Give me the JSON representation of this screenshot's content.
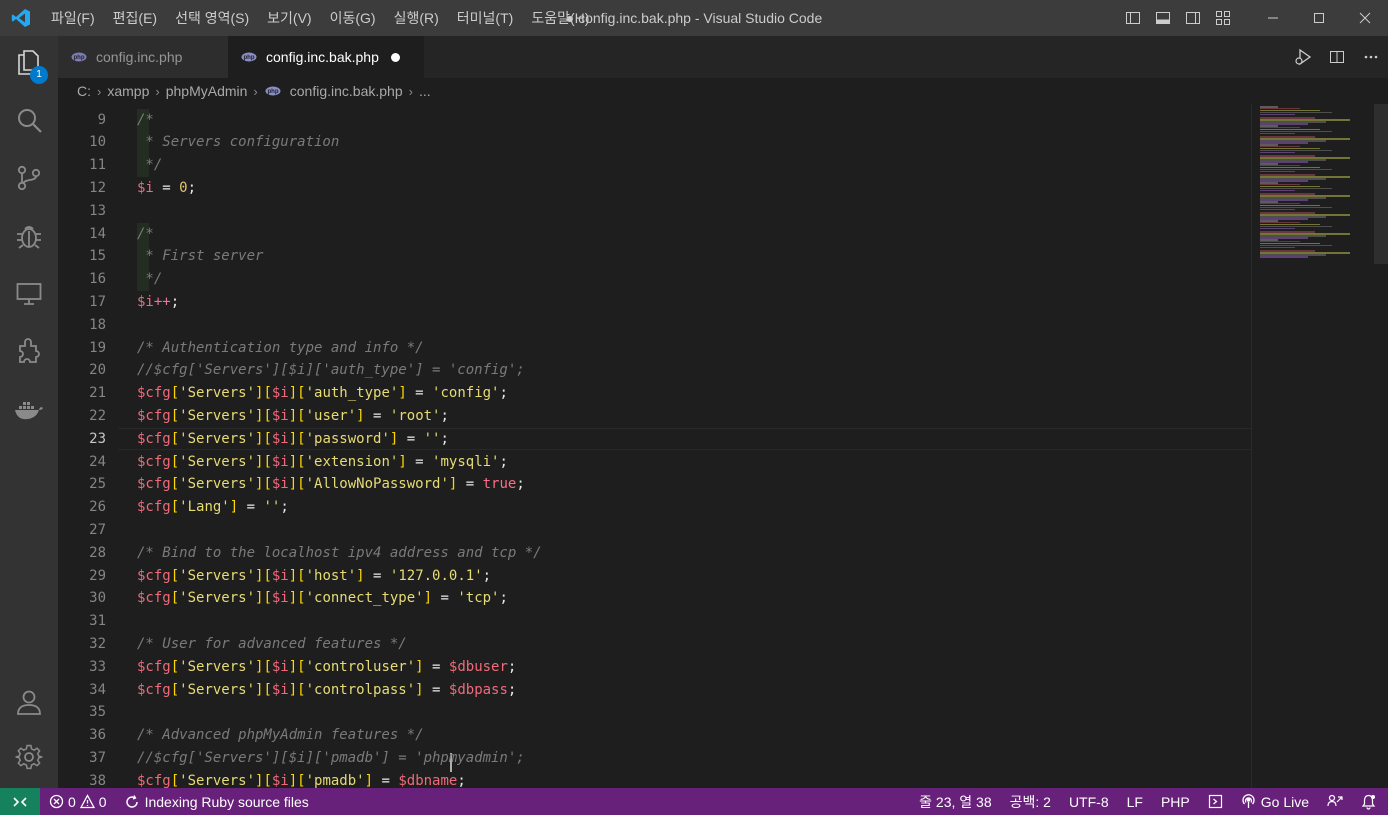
{
  "window": {
    "title": "● config.inc.bak.php - Visual Studio Code",
    "menu": [
      "파일(F)",
      "편집(E)",
      "선택 영역(S)",
      "보기(V)",
      "이동(G)",
      "실행(R)",
      "터미널(T)",
      "도움말(H)"
    ]
  },
  "activity_bar": {
    "explorer_badge": "1",
    "icons": [
      "explorer-icon",
      "search-icon",
      "source-control-icon",
      "debug-icon",
      "remote-explorer-icon",
      "extensions-icon",
      "docker-icon",
      "account-icon",
      "settings-gear-icon"
    ]
  },
  "tabs": [
    {
      "label": "config.inc.php",
      "active": false
    },
    {
      "label": "config.inc.bak.php",
      "active": true,
      "dirty": true
    }
  ],
  "breadcrumb": [
    "C:",
    "xampp",
    "phpMyAdmin",
    "config.inc.bak.php",
    "..."
  ],
  "editor": {
    "active_line": 23,
    "lines": [
      {
        "n": "9",
        "tokens": [
          [
            "c-com",
            "/*"
          ]
        ]
      },
      {
        "n": "10",
        "tokens": [
          [
            "c-com",
            " * Servers configuration"
          ]
        ]
      },
      {
        "n": "11",
        "tokens": [
          [
            "c-com",
            " */"
          ]
        ]
      },
      {
        "n": "12",
        "tokens": [
          [
            "c-var",
            "$i"
          ],
          [
            "c-plain",
            " = "
          ],
          [
            "c-num",
            "0"
          ],
          [
            "c-plain",
            ";"
          ]
        ]
      },
      {
        "n": "13",
        "tokens": []
      },
      {
        "n": "14",
        "tokens": [
          [
            "c-com",
            "/*"
          ]
        ]
      },
      {
        "n": "15",
        "tokens": [
          [
            "c-com",
            " * First server"
          ]
        ]
      },
      {
        "n": "16",
        "tokens": [
          [
            "c-com",
            " */"
          ]
        ]
      },
      {
        "n": "17",
        "tokens": [
          [
            "c-var",
            "$i"
          ],
          [
            "c-op",
            "++"
          ],
          [
            "c-plain",
            ";"
          ]
        ]
      },
      {
        "n": "18",
        "tokens": []
      },
      {
        "n": "19",
        "tokens": [
          [
            "c-com",
            "/* Authentication type and info */"
          ]
        ]
      },
      {
        "n": "20",
        "tokens": [
          [
            "c-com",
            "//$cfg['Servers'][$i]['auth_type'] = 'config';"
          ]
        ]
      },
      {
        "n": "21",
        "tokens": [
          [
            "c-var",
            "$cfg"
          ],
          [
            "c-br",
            "["
          ],
          [
            "c-str",
            "'Servers'"
          ],
          [
            "c-br",
            "]["
          ],
          [
            "c-var",
            "$i"
          ],
          [
            "c-br",
            "]["
          ],
          [
            "c-str",
            "'auth_type'"
          ],
          [
            "c-br",
            "]"
          ],
          [
            "c-plain",
            " = "
          ],
          [
            "c-str",
            "'config'"
          ],
          [
            "c-plain",
            ";"
          ]
        ]
      },
      {
        "n": "22",
        "tokens": [
          [
            "c-var",
            "$cfg"
          ],
          [
            "c-br",
            "["
          ],
          [
            "c-str",
            "'Servers'"
          ],
          [
            "c-br",
            "]["
          ],
          [
            "c-var",
            "$i"
          ],
          [
            "c-br",
            "]["
          ],
          [
            "c-str",
            "'user'"
          ],
          [
            "c-br",
            "]"
          ],
          [
            "c-plain",
            " = "
          ],
          [
            "c-str",
            "'root'"
          ],
          [
            "c-plain",
            ";"
          ]
        ]
      },
      {
        "n": "23",
        "tokens": [
          [
            "c-var",
            "$cfg"
          ],
          [
            "c-br",
            "["
          ],
          [
            "c-str",
            "'Servers'"
          ],
          [
            "c-br",
            "]["
          ],
          [
            "c-var",
            "$i"
          ],
          [
            "c-br",
            "]["
          ],
          [
            "c-str",
            "'password'"
          ],
          [
            "c-br",
            "]"
          ],
          [
            "c-plain",
            " = "
          ],
          [
            "c-str",
            "''"
          ],
          [
            "c-plain",
            ";"
          ]
        ]
      },
      {
        "n": "24",
        "tokens": [
          [
            "c-var",
            "$cfg"
          ],
          [
            "c-br",
            "["
          ],
          [
            "c-str",
            "'Servers'"
          ],
          [
            "c-br",
            "]["
          ],
          [
            "c-var",
            "$i"
          ],
          [
            "c-br",
            "]["
          ],
          [
            "c-str",
            "'extension'"
          ],
          [
            "c-br",
            "]"
          ],
          [
            "c-plain",
            " = "
          ],
          [
            "c-str",
            "'mysqli'"
          ],
          [
            "c-plain",
            ";"
          ]
        ]
      },
      {
        "n": "25",
        "tokens": [
          [
            "c-var",
            "$cfg"
          ],
          [
            "c-br",
            "["
          ],
          [
            "c-str",
            "'Servers'"
          ],
          [
            "c-br",
            "]["
          ],
          [
            "c-var",
            "$i"
          ],
          [
            "c-br",
            "]["
          ],
          [
            "c-str",
            "'AllowNoPassword'"
          ],
          [
            "c-br",
            "]"
          ],
          [
            "c-plain",
            " = "
          ],
          [
            "c-bool",
            "true"
          ],
          [
            "c-plain",
            ";"
          ]
        ]
      },
      {
        "n": "26",
        "tokens": [
          [
            "c-var",
            "$cfg"
          ],
          [
            "c-br",
            "["
          ],
          [
            "c-str",
            "'Lang'"
          ],
          [
            "c-br",
            "]"
          ],
          [
            "c-plain",
            " = "
          ],
          [
            "c-str",
            "''"
          ],
          [
            "c-plain",
            ";"
          ]
        ]
      },
      {
        "n": "27",
        "tokens": []
      },
      {
        "n": "28",
        "tokens": [
          [
            "c-com",
            "/* Bind to the localhost ipv4 address and tcp */"
          ]
        ]
      },
      {
        "n": "29",
        "tokens": [
          [
            "c-var",
            "$cfg"
          ],
          [
            "c-br",
            "["
          ],
          [
            "c-str",
            "'Servers'"
          ],
          [
            "c-br",
            "]["
          ],
          [
            "c-var",
            "$i"
          ],
          [
            "c-br",
            "]["
          ],
          [
            "c-str",
            "'host'"
          ],
          [
            "c-br",
            "]"
          ],
          [
            "c-plain",
            " = "
          ],
          [
            "c-str",
            "'127.0.0.1'"
          ],
          [
            "c-plain",
            ";"
          ]
        ]
      },
      {
        "n": "30",
        "tokens": [
          [
            "c-var",
            "$cfg"
          ],
          [
            "c-br",
            "["
          ],
          [
            "c-str",
            "'Servers'"
          ],
          [
            "c-br",
            "]["
          ],
          [
            "c-var",
            "$i"
          ],
          [
            "c-br",
            "]["
          ],
          [
            "c-str",
            "'connect_type'"
          ],
          [
            "c-br",
            "]"
          ],
          [
            "c-plain",
            " = "
          ],
          [
            "c-str",
            "'tcp'"
          ],
          [
            "c-plain",
            ";"
          ]
        ]
      },
      {
        "n": "31",
        "tokens": []
      },
      {
        "n": "32",
        "tokens": [
          [
            "c-com",
            "/* User for advanced features */"
          ]
        ]
      },
      {
        "n": "33",
        "tokens": [
          [
            "c-var",
            "$cfg"
          ],
          [
            "c-br",
            "["
          ],
          [
            "c-str",
            "'Servers'"
          ],
          [
            "c-br",
            "]["
          ],
          [
            "c-var",
            "$i"
          ],
          [
            "c-br",
            "]["
          ],
          [
            "c-str",
            "'controluser'"
          ],
          [
            "c-br",
            "]"
          ],
          [
            "c-plain",
            " = "
          ],
          [
            "c-var",
            "$dbuser"
          ],
          [
            "c-plain",
            ";"
          ]
        ]
      },
      {
        "n": "34",
        "tokens": [
          [
            "c-var",
            "$cfg"
          ],
          [
            "c-br",
            "["
          ],
          [
            "c-str",
            "'Servers'"
          ],
          [
            "c-br",
            "]["
          ],
          [
            "c-var",
            "$i"
          ],
          [
            "c-br",
            "]["
          ],
          [
            "c-str",
            "'controlpass'"
          ],
          [
            "c-br",
            "]"
          ],
          [
            "c-plain",
            " = "
          ],
          [
            "c-var",
            "$dbpass"
          ],
          [
            "c-plain",
            ";"
          ]
        ]
      },
      {
        "n": "35",
        "tokens": []
      },
      {
        "n": "36",
        "tokens": [
          [
            "c-com",
            "/* Advanced phpMyAdmin features */"
          ]
        ]
      },
      {
        "n": "37",
        "tokens": [
          [
            "c-com",
            "//$cfg['Servers'][$i]['pmadb'] = 'phpmyadmin';"
          ]
        ]
      },
      {
        "n": "38",
        "tokens": [
          [
            "c-var",
            "$cfg"
          ],
          [
            "c-br",
            "["
          ],
          [
            "c-str",
            "'Servers'"
          ],
          [
            "c-br",
            "]["
          ],
          [
            "c-var",
            "$i"
          ],
          [
            "c-br",
            "]["
          ],
          [
            "c-str",
            "'pmadb'"
          ],
          [
            "c-br",
            "]"
          ],
          [
            "c-plain",
            " = "
          ],
          [
            "c-var",
            "$dbname"
          ],
          [
            "c-plain",
            ";"
          ]
        ]
      }
    ]
  },
  "status_bar": {
    "problems_errors": "0",
    "problems_warnings": "0",
    "task": "Indexing Ruby source files",
    "cursor_position": "줄 23, 열 38",
    "indentation": "공백: 2",
    "encoding": "UTF-8",
    "eol": "LF",
    "language": "PHP",
    "go_live": "Go Live"
  },
  "colors": {
    "statusbar_bg": "#68217a",
    "remote_bg": "#16825d",
    "badge_bg": "#007acc"
  }
}
